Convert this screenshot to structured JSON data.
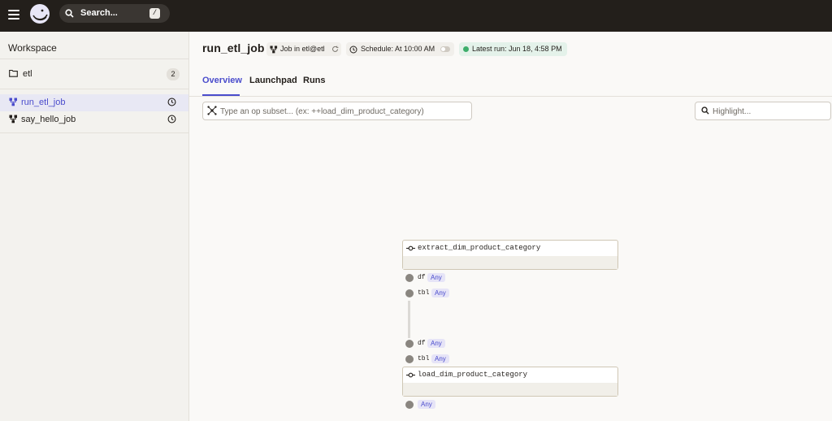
{
  "topbar": {
    "search_label": "Search...",
    "search_shortcut": "/"
  },
  "sidebar": {
    "title": "Workspace",
    "location": {
      "name": "etl",
      "count": "2"
    },
    "jobs": [
      {
        "name": "run_etl_job",
        "active": true
      },
      {
        "name": "say_hello_job",
        "active": false
      }
    ]
  },
  "header": {
    "job_title": "run_etl_job",
    "job_tag": "Job in etl@etl",
    "schedule_tag": "Schedule: At 10:00 AM",
    "latest_run_tag": "Latest run: Jun 18, 4:58 PM"
  },
  "tabs": [
    "Overview",
    "Launchpad",
    "Runs"
  ],
  "filters": {
    "subset_placeholder": "Type an op subset... (ex: ++load_dim_product_category)",
    "highlight_placeholder": "Highlight..."
  },
  "graph": {
    "ops": [
      {
        "name": "extract_dim_product_category",
        "outputs": [
          {
            "name": "df",
            "type": "Any"
          },
          {
            "name": "tbl",
            "type": "Any"
          }
        ]
      },
      {
        "name": "load_dim_product_category",
        "inputs": [
          {
            "name": "df",
            "type": "Any"
          },
          {
            "name": "tbl",
            "type": "Any"
          }
        ],
        "outputs": [
          {
            "name": "",
            "type": "Any"
          }
        ]
      }
    ]
  },
  "colors": {
    "topbar": "#231f1b",
    "accent": "#4a4ccc",
    "success": "#3eae6b",
    "sidebar_bg": "#f3f2ee"
  }
}
